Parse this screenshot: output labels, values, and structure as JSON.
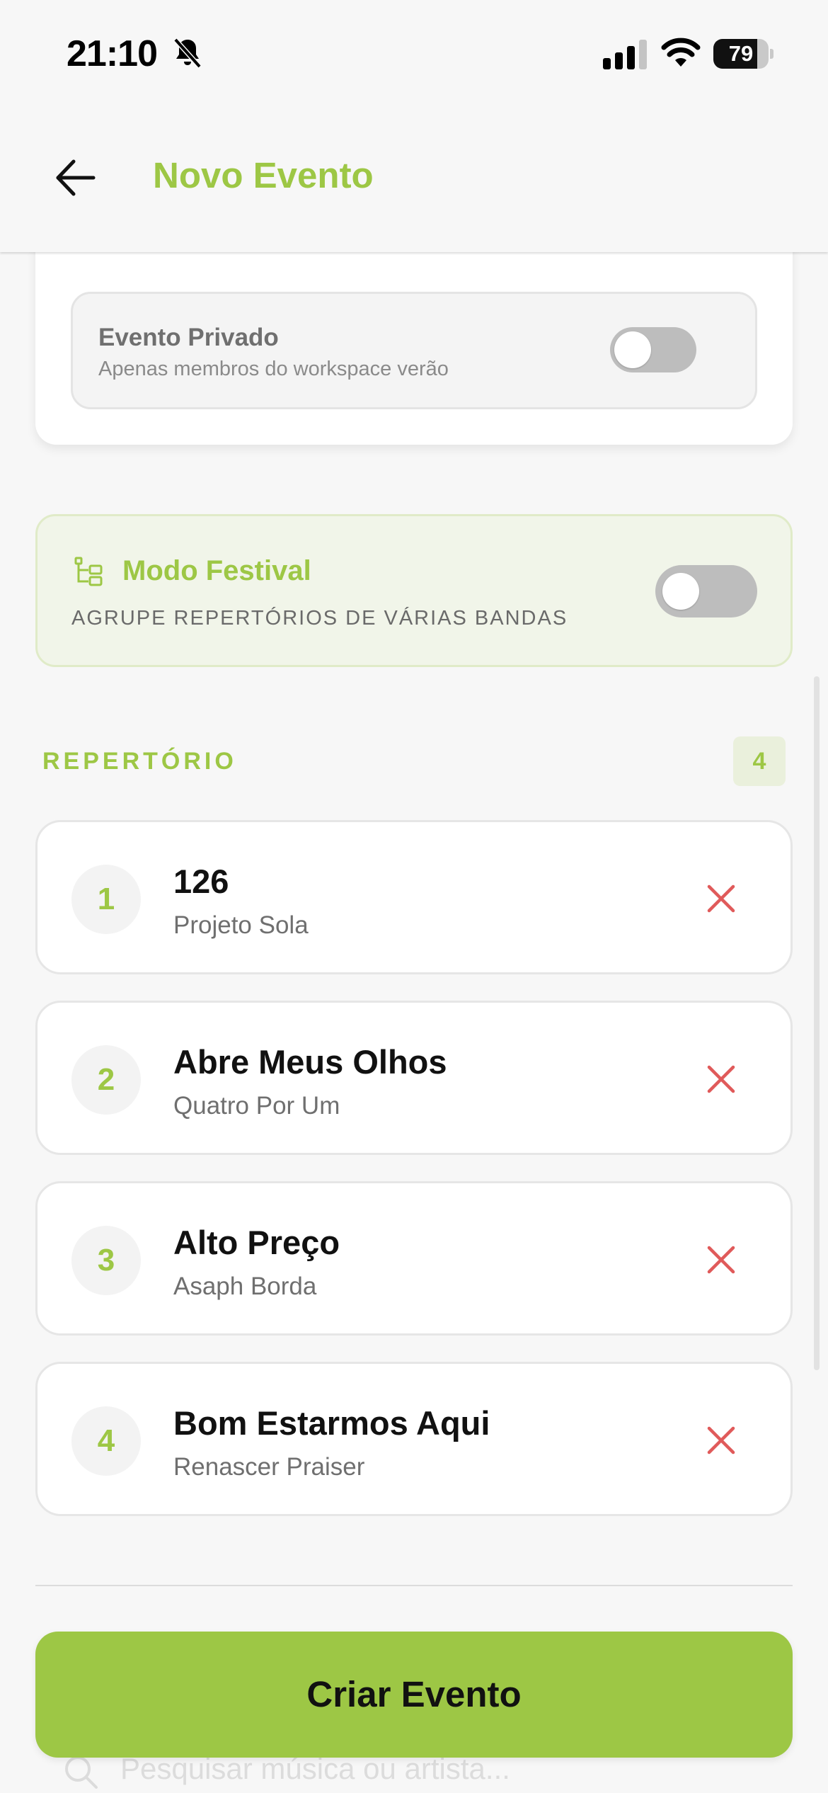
{
  "status_bar": {
    "time": "21:10",
    "battery": "79",
    "battery_fraction": 0.79
  },
  "header": {
    "title": "Novo Evento"
  },
  "privacy": {
    "title": "Evento Privado",
    "subtitle": "Apenas membros do workspace verão",
    "enabled": false
  },
  "festival": {
    "title": "Modo Festival",
    "subtitle": "AGRUPE REPERTÓRIOS DE VÁRIAS BANDAS",
    "enabled": false
  },
  "repertoire": {
    "label": "REPERTÓRIO",
    "count": "4",
    "songs": [
      {
        "number": "1",
        "title": "126",
        "artist": "Projeto Sola"
      },
      {
        "number": "2",
        "title": "Abre Meus Olhos",
        "artist": "Quatro Por Um"
      },
      {
        "number": "3",
        "title": "Alto Preço",
        "artist": "Asaph Borda"
      },
      {
        "number": "4",
        "title": "Bom Estarmos Aqui",
        "artist": "Renascer Praiser"
      }
    ]
  },
  "search": {
    "placeholder": "Pesquisar música ou artista..."
  },
  "actions": {
    "create_label": "Criar Evento"
  },
  "colors": {
    "accent": "#9dc745",
    "danger": "#e05a5a"
  }
}
